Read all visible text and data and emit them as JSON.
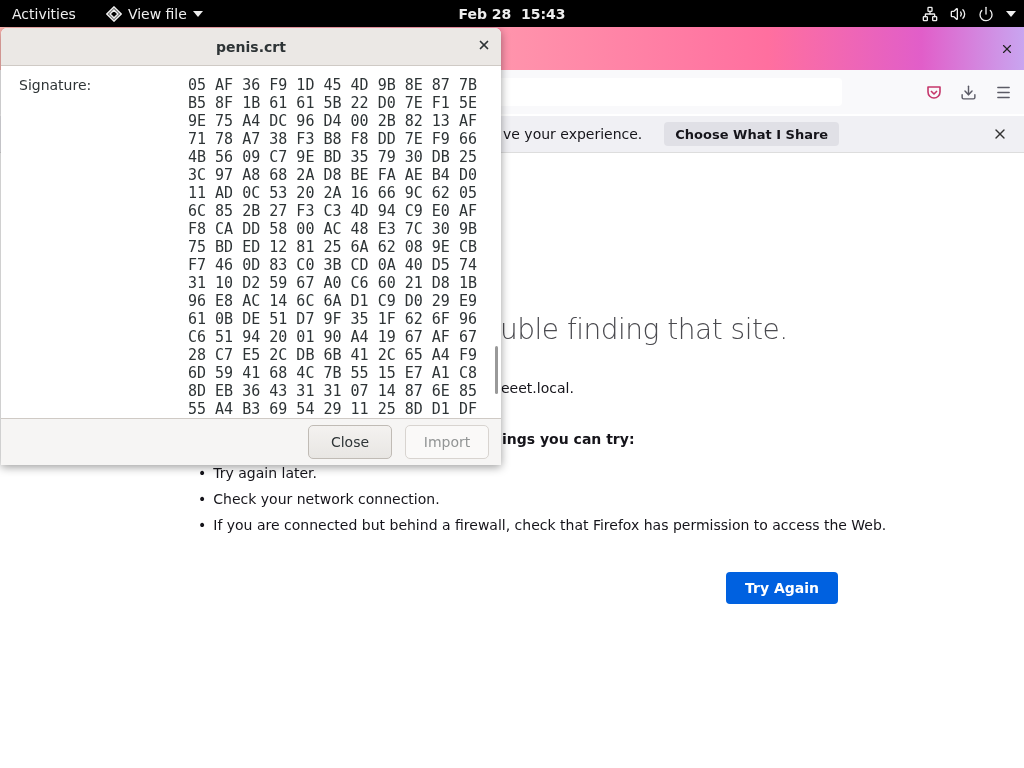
{
  "top_bar": {
    "activities": "Activities",
    "app_menu": "View file",
    "clock": "Feb 28  15:43"
  },
  "browser": {
    "notification": {
      "message": "ve your experience.",
      "button": "Choose What I Share"
    },
    "error_page": {
      "title": "uble finding that site.",
      "host_text": "eeet.local.",
      "suggestions_heading": "ings you can try:",
      "suggestions": [
        {
          "bullet": "•",
          "text": "Try again later."
        },
        {
          "bullet": "•",
          "text": "Check your network connection."
        },
        {
          "bullet": "•",
          "text": "If you are connected but behind a firewall, check that Firefox has permission to access the Web."
        }
      ],
      "button": "Try Again"
    }
  },
  "dialog": {
    "title": "penis.crt",
    "fields": [
      {
        "label": "Signature:",
        "value_lines": [
          "05 AF 36 F9 1D 45 4D 9B 8E 87 7B",
          "B5 8F 1B 61 61 5B 22 D0 7E F1 5E",
          "9E 75 A4 DC 96 D4 00 2B 82 13 AF",
          "71 78 A7 38 F3 B8 F8 DD 7E F9 66",
          "4B 56 09 C7 9E BD 35 79 30 DB 25",
          "3C 97 A8 68 2A D8 BE FA AE B4 D0",
          "11 AD 0C 53 20 2A 16 66 9C 62 05",
          "6C 85 2B 27 F3 C3 4D 94 C9 E0 AF",
          "F8 CA DD 58 00 AC 48 E3 7C 30 9B",
          "75 BD ED 12 81 25 6A 62 08 9E CB",
          "F7 46 0D 83 C0 3B CD 0A 40 D5 74",
          "31 10 D2 59 67 A0 C6 60 21 D8 1B",
          "96 E8 AC 14 6C 6A D1 C9 D0 29 E9",
          "61 0B DE 51 D7 9F 35 1F 62 6F 96",
          "C6 51 94 20 01 90 A4 19 67 AF 67",
          "28 C7 E5 2C DB 6B 41 2C 65 A4 F9",
          "6D 59 41 68 4C 7B 55 15 E7 A1 C8",
          "8D EB 36 43 31 31 07 14 87 6E 85",
          "55 A4 B3 69 54 29 11 25 8D D1 DF"
        ]
      }
    ],
    "buttons": [
      {
        "label": "Close",
        "disabled": false
      },
      {
        "label": "Import",
        "disabled": true
      }
    ]
  }
}
